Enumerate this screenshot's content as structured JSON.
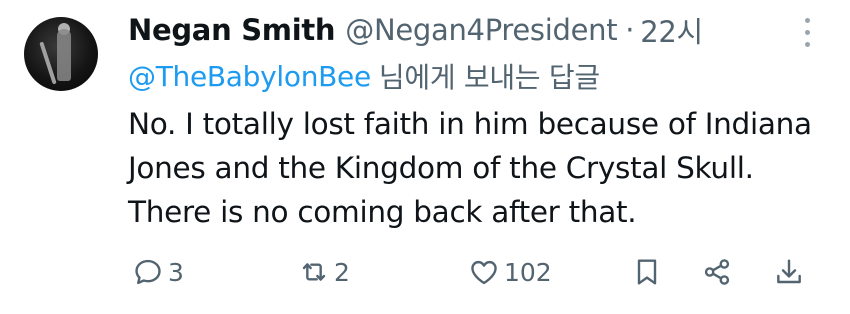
{
  "tweet": {
    "display_name": "Negan Smith",
    "handle": "@Negan4President",
    "separator": "·",
    "time": "22시",
    "reply_to_handle": "@TheBabylonBee",
    "reply_to_suffix": "님에게 보내는 답글",
    "body_lines": [
      "No. I totally lost faith in him because of Indiana",
      "Jones and the Kingdom of the Crystal Skull.",
      "There is no coming back after that."
    ]
  },
  "actions": {
    "reply_count": "3",
    "retweet_count": "2",
    "like_count": "102"
  },
  "icons": {
    "reply": "reply-icon",
    "retweet": "retweet-icon",
    "like": "heart-icon",
    "bookmark": "bookmark-icon",
    "share": "share-icon",
    "download": "download-icon",
    "more": "more-icon"
  },
  "colors": {
    "text": "#0f1419",
    "secondary": "#536471",
    "mention": "#1d9bf0"
  }
}
